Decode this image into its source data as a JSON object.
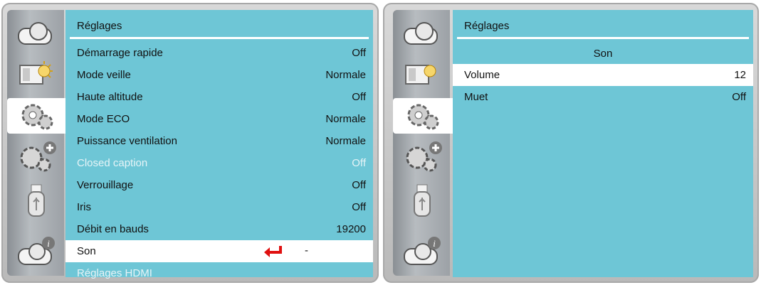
{
  "colors": {
    "content_bg": "#6ec6d6",
    "selected_bg": "#ffffff",
    "disabled_text": "#e6f4f7",
    "enter_arrow": "#e01010"
  },
  "sidebar_icons": [
    "projector-icon",
    "picture-sun-icon",
    "gears-icon",
    "gears-plus-icon",
    "usb-drive-icon",
    "projector-info-icon"
  ],
  "left": {
    "title": "Réglages",
    "rows": [
      {
        "label": "Démarrage rapide",
        "value": "Off"
      },
      {
        "label": "Mode veille",
        "value": "Normale"
      },
      {
        "label": "Haute altitude",
        "value": "Off"
      },
      {
        "label": "Mode ECO",
        "value": "Normale"
      },
      {
        "label": "Puissance ventilation",
        "value": "Normale"
      },
      {
        "label": "Closed caption",
        "value": "Off",
        "disabled": true
      },
      {
        "label": "Verrouillage",
        "value": "Off"
      },
      {
        "label": "Iris",
        "value": "Off"
      },
      {
        "label": "Débit en bauds",
        "value": "19200"
      },
      {
        "label": "Son",
        "value": "-",
        "selected": true
      },
      {
        "label": "Réglages HDMI",
        "value": "",
        "disabled": true
      }
    ]
  },
  "right": {
    "title": "Réglages",
    "subtitle": "Son",
    "rows": [
      {
        "label": "Volume",
        "value": "12",
        "selected": true
      },
      {
        "label": "Muet",
        "value": "Off"
      }
    ]
  }
}
